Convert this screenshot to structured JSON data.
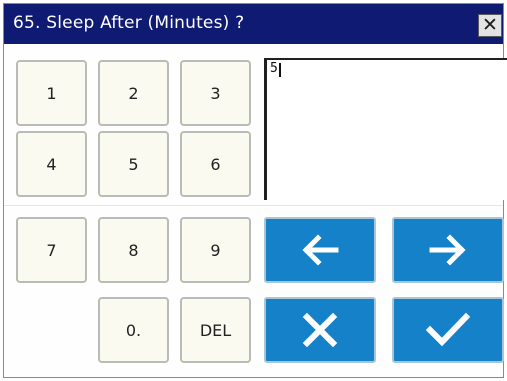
{
  "dialog": {
    "title": "65. Sleep After (Minutes) ?",
    "close_label": "✕"
  },
  "input": {
    "value": "5"
  },
  "keypad": {
    "keys": [
      "1",
      "2",
      "3",
      "4",
      "5",
      "6",
      "7",
      "8",
      "9",
      "0.",
      "DEL"
    ]
  },
  "actions": {
    "left_icon": "arrow-left-icon",
    "right_icon": "arrow-right-icon",
    "cancel_icon": "cancel-x-icon",
    "ok_icon": "checkmark-icon"
  },
  "colors": {
    "title_bar": "#0f1a72",
    "action_button": "#1581c8",
    "key_face": "#fbfaf0"
  }
}
